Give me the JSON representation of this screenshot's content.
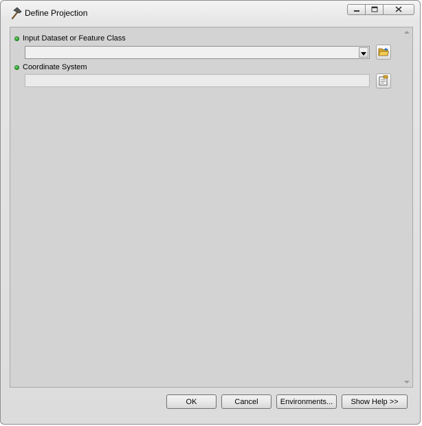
{
  "window": {
    "title": "Define Projection",
    "icons": {
      "app": "hammer-icon",
      "minimize": "minimize-icon",
      "maximize": "maximize-icon",
      "close": "close-icon"
    }
  },
  "params": [
    {
      "label": "Input Dataset or Feature Class",
      "value": "",
      "required": true,
      "control": "dropdown",
      "browse_icon": "open-folder-icon"
    },
    {
      "label": "Coordinate System",
      "value": "",
      "required": true,
      "control": "text",
      "browse_icon": "properties-icon"
    }
  ],
  "colors": {
    "required_dot": "#22aa22",
    "panel": "#d3d3d3",
    "window": "#e3e3e3"
  },
  "buttons": {
    "ok": "OK",
    "cancel": "Cancel",
    "environments": "Environments...",
    "show_help": "Show Help >>"
  }
}
